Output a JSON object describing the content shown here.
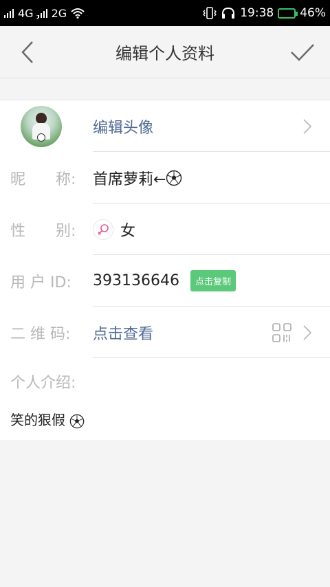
{
  "status_bar": {
    "network1": "4G",
    "network2": "2G",
    "sim2_index": "2",
    "time": "19:38",
    "battery": "46%",
    "battery_level": 0.46
  },
  "header": {
    "title": "编辑个人资料"
  },
  "profile": {
    "avatar_action": "编辑头像",
    "nickname_label": "昵　　称:",
    "nickname_value": "首席萝莉←",
    "gender_label": "性　　别:",
    "gender_value": "女",
    "userid_label": "用 户 ID:",
    "userid_value": "393136646",
    "copy_label": "点击复制",
    "qrcode_label": "二 维 码:",
    "qrcode_action": "点击查看",
    "intro_label": "个人介绍:",
    "intro_text": "笑的狠假"
  },
  "colors": {
    "link": "#4f6a94",
    "label": "#b8b8b8",
    "copy_badge": "#5bc87a",
    "battery": "#39c265"
  },
  "icons": {
    "back": "chevron-left-icon",
    "done": "check-icon",
    "chevron": "chevron-right-icon",
    "gender": "female-icon",
    "qrcode": "qr-code-icon",
    "emoji": "soccer-ball-icon"
  }
}
